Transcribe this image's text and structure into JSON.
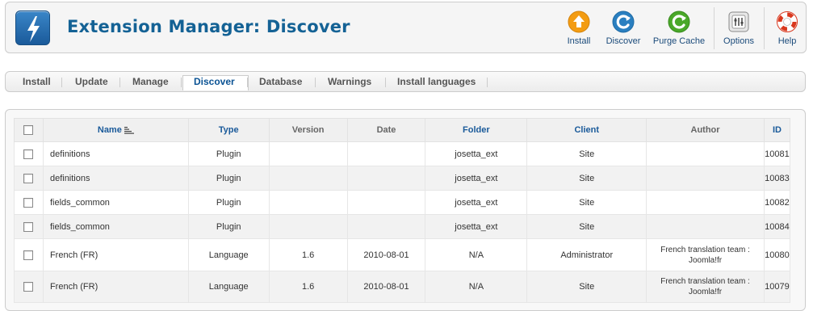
{
  "header": {
    "title": "Extension Manager: Discover",
    "toolbar": [
      {
        "label": "Install",
        "icon": "install-icon",
        "color": "#f39c12"
      },
      {
        "label": "Discover",
        "icon": "discover-icon",
        "color": "#2a7fc0"
      },
      {
        "label": "Purge Cache",
        "icon": "purge-cache-icon",
        "color": "#4aa829"
      },
      {
        "label": "Options",
        "icon": "options-icon",
        "color": "#888888"
      },
      {
        "label": "Help",
        "icon": "help-icon",
        "color": "#d9381e"
      }
    ]
  },
  "submenu": {
    "tabs": [
      "Install",
      "Update",
      "Manage",
      "Discover",
      "Database",
      "Warnings",
      "Install languages"
    ],
    "active": "Discover"
  },
  "table": {
    "columns": [
      "Name",
      "Type",
      "Version",
      "Date",
      "Folder",
      "Client",
      "Author",
      "ID"
    ],
    "rows": [
      {
        "name": "definitions",
        "type": "Plugin",
        "version": "",
        "date": "",
        "folder": "josetta_ext",
        "client": "Site",
        "author": "",
        "id": "10081"
      },
      {
        "name": "definitions",
        "type": "Plugin",
        "version": "",
        "date": "",
        "folder": "josetta_ext",
        "client": "Site",
        "author": "",
        "id": "10083"
      },
      {
        "name": "fields_common",
        "type": "Plugin",
        "version": "",
        "date": "",
        "folder": "josetta_ext",
        "client": "Site",
        "author": "",
        "id": "10082"
      },
      {
        "name": "fields_common",
        "type": "Plugin",
        "version": "",
        "date": "",
        "folder": "josetta_ext",
        "client": "Site",
        "author": "",
        "id": "10084"
      },
      {
        "name": "French (FR)",
        "type": "Language",
        "version": "1.6",
        "date": "2010-08-01",
        "folder": "N/A",
        "client": "Administrator",
        "author": "French translation team : Joomla!fr",
        "id": "10080"
      },
      {
        "name": "French (FR)",
        "type": "Language",
        "version": "1.6",
        "date": "2010-08-01",
        "folder": "N/A",
        "client": "Site",
        "author": "French translation team : Joomla!fr",
        "id": "10079"
      }
    ]
  }
}
